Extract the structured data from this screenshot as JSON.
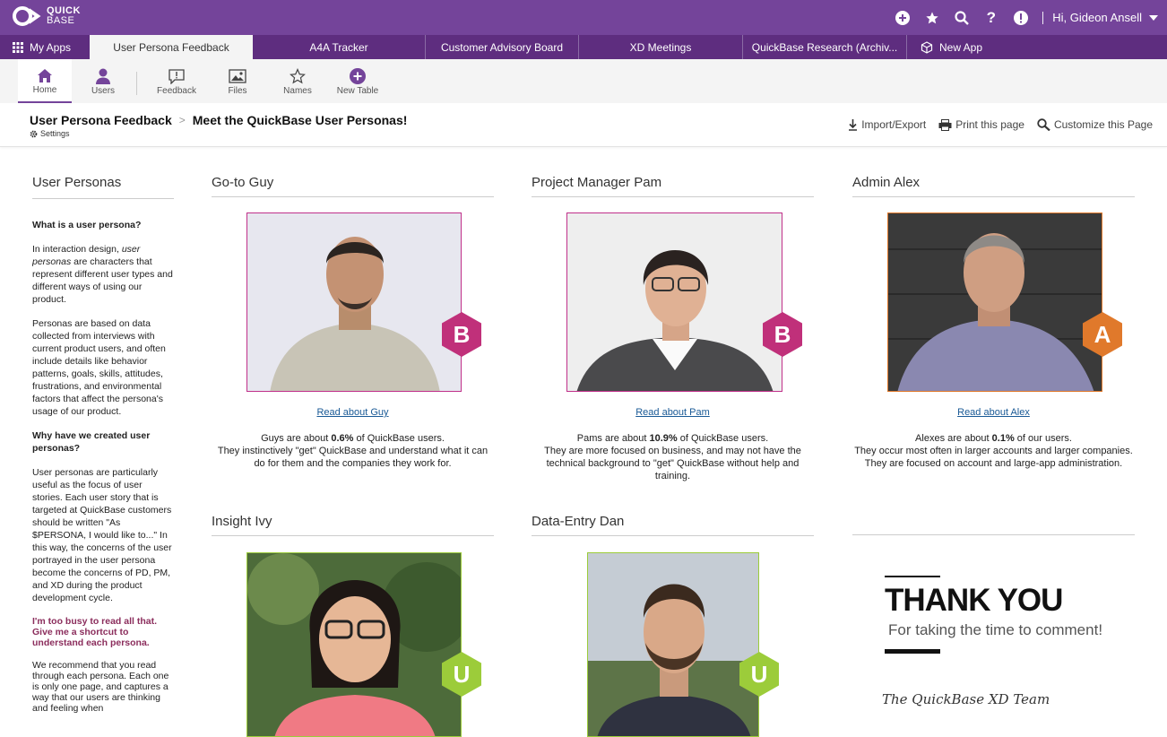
{
  "brand": {
    "logo_line1": "QUICK",
    "logo_line2": "BASE",
    "accent": "#74449a",
    "tab_bg": "#5e2d7f"
  },
  "topbar": {
    "user_greeting": "Hi, Gideon Ansell",
    "icons": [
      "plus-circle-icon",
      "star-icon",
      "search-icon",
      "help-icon",
      "alert-icon"
    ]
  },
  "tabs": [
    {
      "label": "My Apps"
    },
    {
      "label": "User Persona Feedback"
    },
    {
      "label": "A4A Tracker"
    },
    {
      "label": "Customer Advisory Board"
    },
    {
      "label": "XD Meetings"
    },
    {
      "label": "QuickBase Research (Archiv..."
    },
    {
      "label": "New App"
    }
  ],
  "toolbar": [
    {
      "label": "Home"
    },
    {
      "label": "Users"
    },
    {
      "label": "Feedback"
    },
    {
      "label": "Files"
    },
    {
      "label": "Names"
    },
    {
      "label": "New Table"
    }
  ],
  "page": {
    "app_name": "User Persona Feedback",
    "page_title": "Meet the QuickBase User Personas!",
    "settings": "Settings",
    "actions": [
      "Import/Export",
      "Print this page",
      "Customize this Page"
    ]
  },
  "sidebar": {
    "title": "User Personas",
    "q1": "What is a user persona?",
    "p1_a": "In interaction design, ",
    "p1_em": "user personas",
    "p1_b": " are characters that represent different user types and different ways of using our product.",
    "p2": "Personas are based on data collected from interviews with current product users, and often include details like behavior patterns, goals, skills, attitudes, frustrations, and environmental factors that affect the persona's usage of our product.",
    "q2": "Why have we created user personas?",
    "p3": "User personas are particularly useful as the focus of user stories. Each user story that is targeted at QuickBase customers should be written \"As $PERSONA, I would like to...\"  In this way, the concerns of the user portrayed in the user persona become the concerns of PD, PM, and XD during the product development cycle.",
    "highlight": "I'm too busy to read all that. Give me a shortcut to understand each persona.",
    "p4": "We recommend that you read through each persona. Each one is only one page, and captures a way that our users are thinking and feeling when"
  },
  "personas": [
    {
      "name": "Go-to Guy",
      "badge": "B",
      "badge_color": "#c0307a",
      "link": "Read about Guy",
      "line1_a": "Guys are about ",
      "line1_b": "0.6%",
      "line1_c": " of QuickBase users.",
      "line2": "They instinctively \"get\" QuickBase and understand what it can do for them and the companies they work for."
    },
    {
      "name": "Project Manager Pam",
      "badge": "B",
      "badge_color": "#c0307a",
      "link": "Read about Pam",
      "line1_a": "Pams are about ",
      "line1_b": "10.9%",
      "line1_c": " of QuickBase users.",
      "line2": "They are more focused on business, and may not have the technical background to \"get\" QuickBase without help and training."
    },
    {
      "name": "Admin Alex",
      "badge": "A",
      "badge_color": "#e0792b",
      "link": "Read about Alex",
      "line1_a": "Alexes are about ",
      "line1_b": "0.1%",
      "line1_c": " of our users.",
      "line2": "They occur most often in larger accounts and larger companies. They are focused on account and large-app administration."
    },
    {
      "name": "Insight Ivy",
      "badge": "U",
      "badge_color": "#9ccc3a"
    },
    {
      "name": "Data-Entry Dan",
      "badge": "U",
      "badge_color": "#9ccc3a"
    }
  ],
  "thankyou": {
    "heading": "THANK YOU",
    "sub": "For taking the time to comment!",
    "sign": "The QuickBase XD Team"
  }
}
